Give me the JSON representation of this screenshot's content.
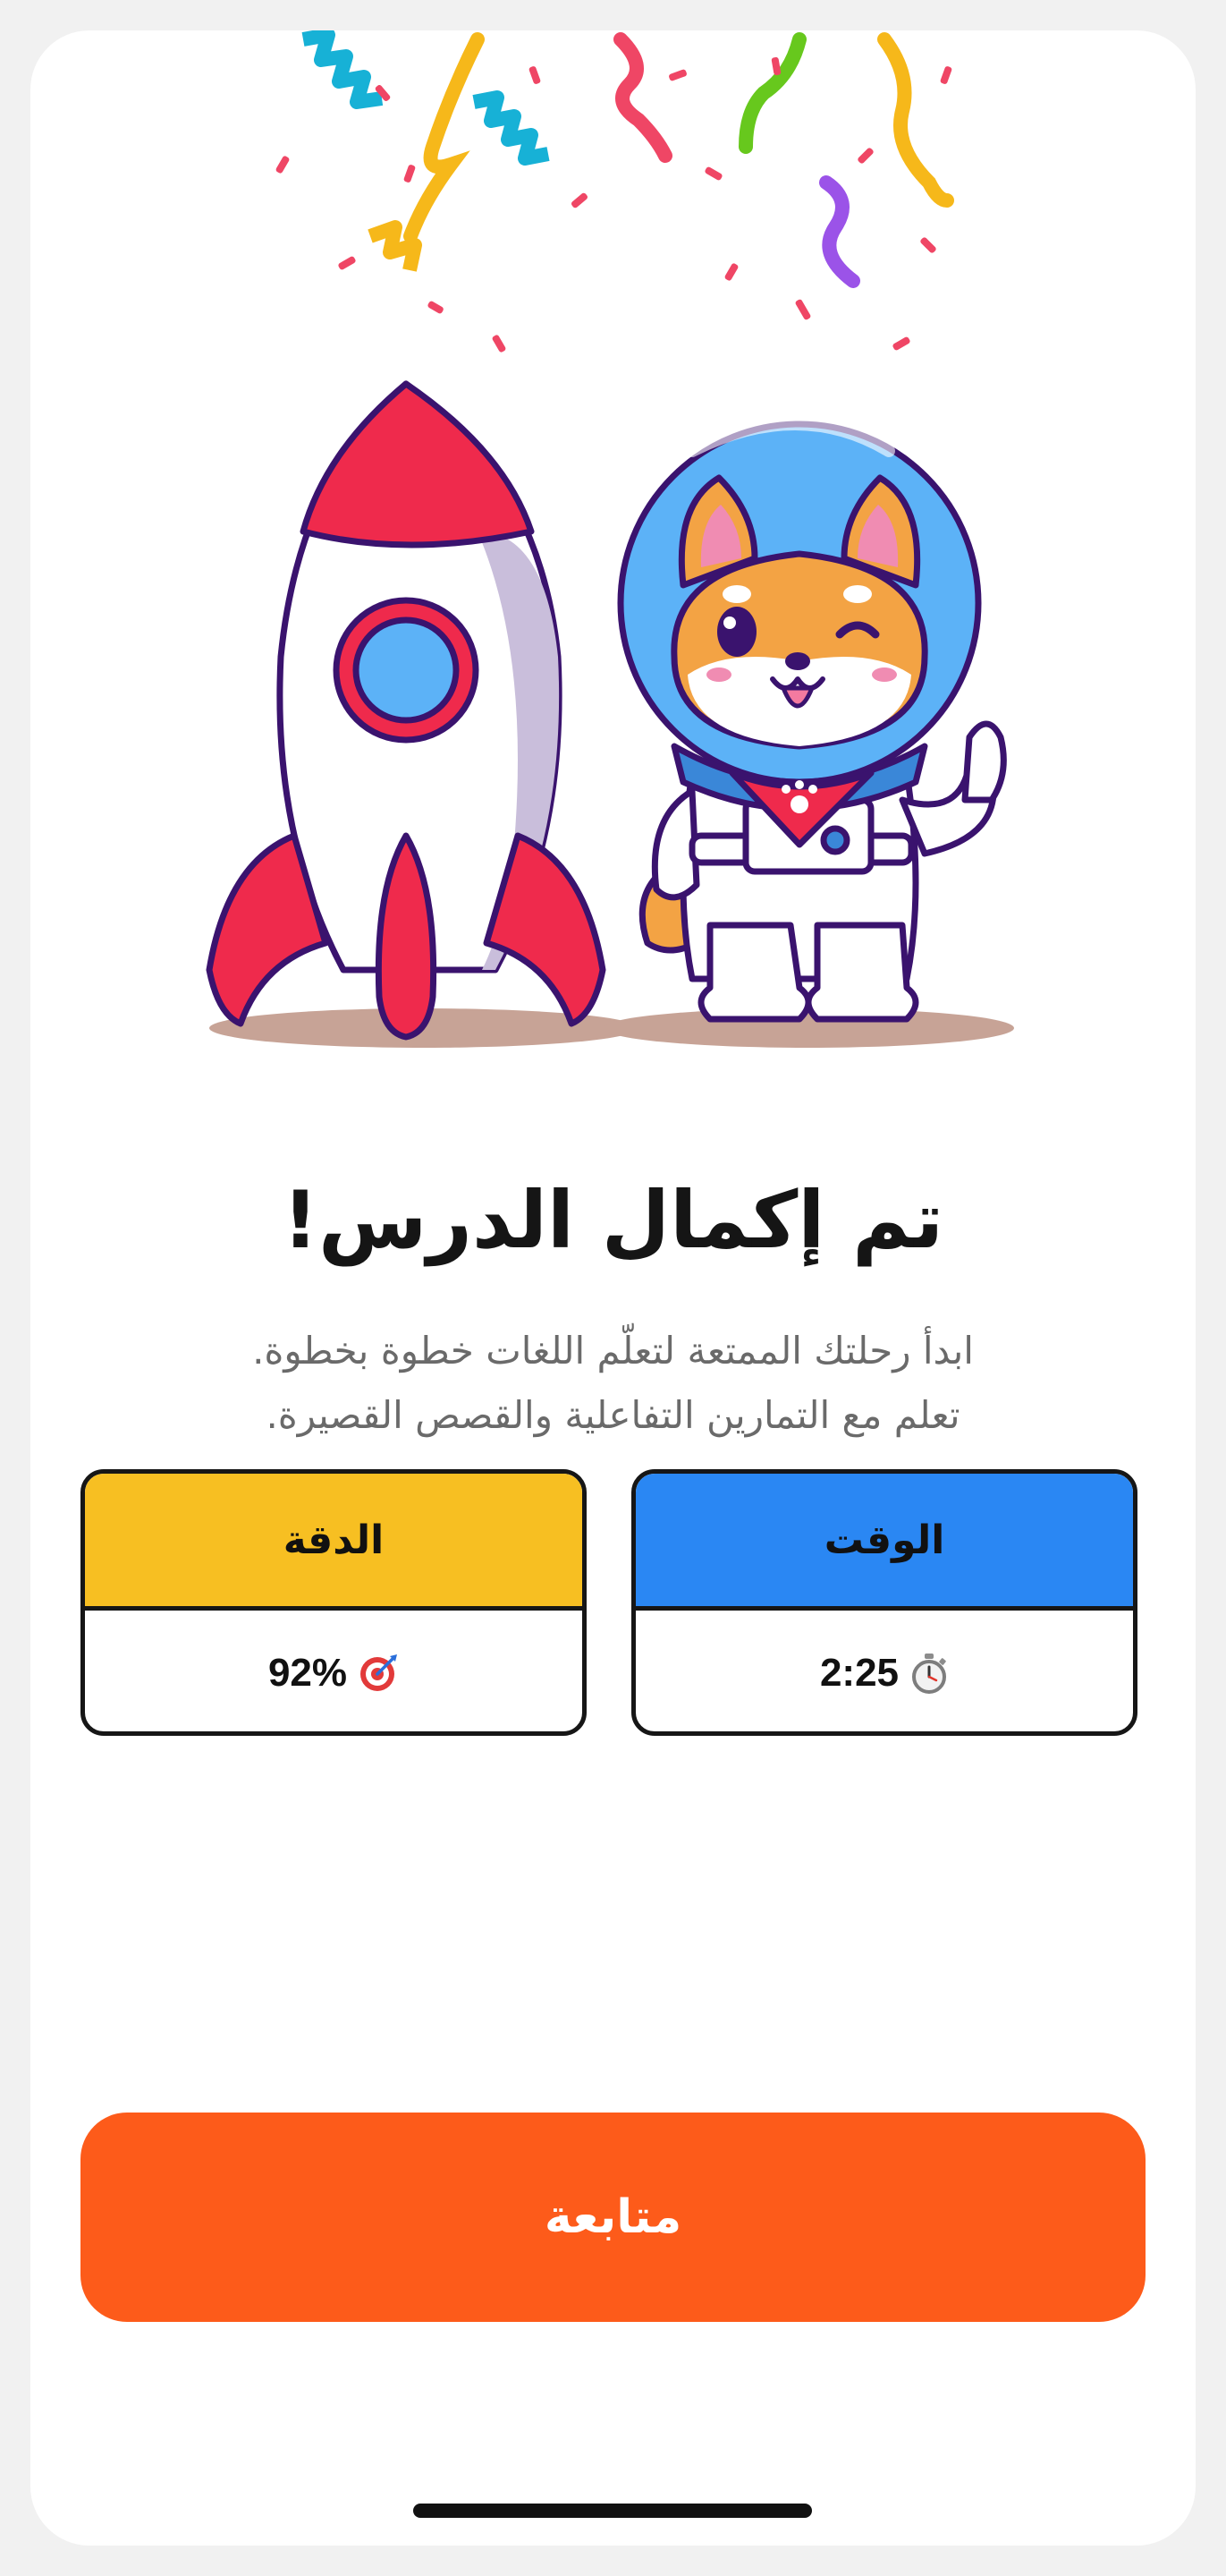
{
  "screen": {
    "title": "تم إكمال الدرس!",
    "subtitle_lines": [
      "ابدأ رحلتك الممتعة لتعلّم اللغات خطوة بخطوة.",
      "تعلم مع التمارين التفاعلية والقصص القصيرة."
    ]
  },
  "stats": {
    "time": {
      "label": "الوقت",
      "value": "2:25",
      "icon": "stopwatch-icon",
      "color": "#2a87f3"
    },
    "accuracy": {
      "label": "الدقة",
      "value": "92%",
      "icon": "target-icon",
      "color": "#f7bf22"
    }
  },
  "continue_button": {
    "label": "متابعة",
    "color": "#fd5b1a"
  },
  "illustration": {
    "subject": "shiba-astronaut-with-rocket",
    "confetti_colors": [
      "#17b1d6",
      "#f6b81a",
      "#ef4665",
      "#67c81d",
      "#9b53e8"
    ]
  }
}
